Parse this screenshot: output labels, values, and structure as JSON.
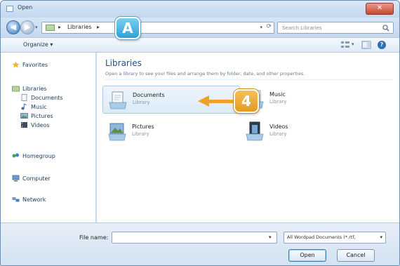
{
  "window": {
    "title": "Open",
    "close_glyph": "✕"
  },
  "address": {
    "breadcrumb": "Libraries",
    "placeholder_search": "Search Libraries"
  },
  "toolbar": {
    "organize_label": "Organize ▾"
  },
  "navigation": {
    "favorites": "Favorites",
    "libraries": "Libraries",
    "library_items": [
      "Documents",
      "Music",
      "Pictures",
      "Videos"
    ],
    "homegroup": "Homegroup",
    "computer": "Computer",
    "network": "Network"
  },
  "content": {
    "title": "Libraries",
    "subtitle": "Open a library to see your files and arrange them by folder, date, and other properties.",
    "libraries": [
      {
        "name": "Documents",
        "type": "Library"
      },
      {
        "name": "Music",
        "type": "Library"
      },
      {
        "name": "Pictures",
        "type": "Library"
      },
      {
        "name": "Videos",
        "type": "Library"
      }
    ]
  },
  "bottom": {
    "filename_label": "File name:",
    "filename_value": "",
    "filetype_value": "All Wordpad Documents (*.rtf,",
    "open_label": "Open",
    "cancel_label": "Cancel"
  },
  "callouts": {
    "a": "A",
    "step": "4"
  },
  "colors": {
    "callout_blue": "#2aa2da",
    "callout_orange": "#eea328",
    "title_blue": "#1e4f8a"
  }
}
